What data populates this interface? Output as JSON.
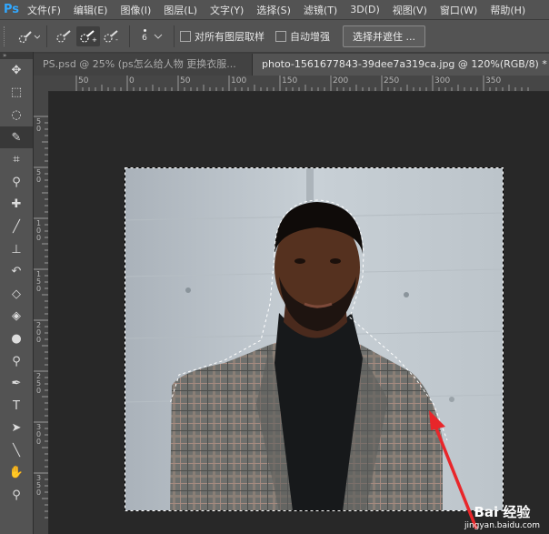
{
  "app": {
    "logo": "Ps"
  },
  "menu": [
    "文件(F)",
    "编辑(E)",
    "图像(I)",
    "图层(L)",
    "文字(Y)",
    "选择(S)",
    "滤镜(T)",
    "3D(D)",
    "视图(V)",
    "窗口(W)",
    "帮助(H)"
  ],
  "options": {
    "brush_size": "6",
    "sample_all_layers_label": "对所有图层取样",
    "auto_enhance_label": "自动增强",
    "select_and_mask_label": "选择并遮住 ..."
  },
  "panel": {
    "collapse": "»"
  },
  "tabs": [
    {
      "label": "PS.psd @ 25% (ps怎么给人物 更换衣服...",
      "close": "×"
    },
    {
      "label": "photo-1561677843-39dee7a319ca.jpg @ 120%(RGB/8) *"
    }
  ],
  "ruler_h": [
    "50",
    "0",
    "50",
    "100",
    "150",
    "200",
    "250",
    "300",
    "350"
  ],
  "ruler_v": [
    "5\n0",
    "5\n0",
    "1\n0\n0",
    "1\n5\n0",
    "2\n0\n0",
    "2\n5\n0",
    "3\n0\n0",
    "3\n5\n0"
  ],
  "tools": [
    "move-icon",
    "marquee-icon",
    "lasso-icon",
    "quick-selection-icon",
    "crop-icon",
    "eyedropper-icon",
    "healing-brush-icon",
    "brush-icon",
    "clone-stamp-icon",
    "history-brush-icon",
    "eraser-icon",
    "paint-bucket-icon",
    "blur-icon",
    "dodge-icon",
    "pen-icon",
    "type-icon",
    "path-selection-icon",
    "line-icon",
    "hand-icon",
    "zoom-icon"
  ],
  "watermark": {
    "brand": "Bai 经验",
    "url": "jingyan.baidu.com"
  },
  "colors": {
    "accent": "#31a8ff",
    "arrow": "#e8262a",
    "panel": "#535353",
    "canvas": "#282828"
  }
}
